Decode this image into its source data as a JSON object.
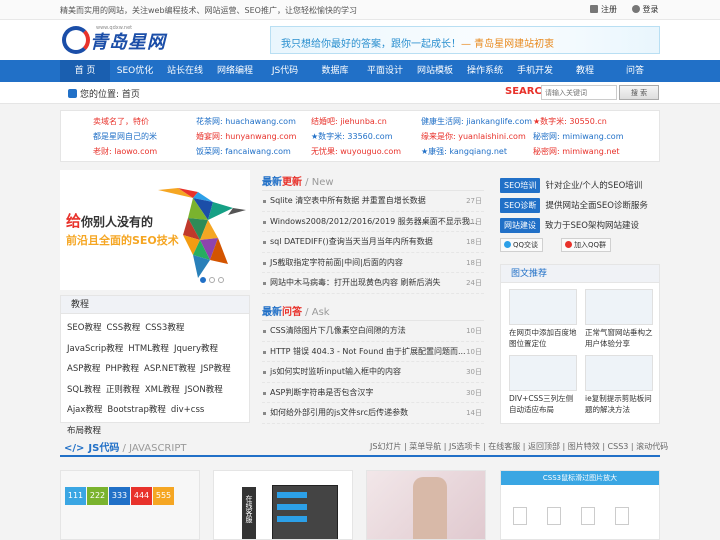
{
  "topbar": {
    "message": "精美而实用的网站，关注web编程技术、网站运营、SEO推广，让您轻松愉快的学习",
    "register": "注册",
    "login": "登录"
  },
  "header": {
    "logo_text": "青岛星网",
    "logo_sub": "www.qdxw.net",
    "banner_text": "我只想给你最好的答案，跟你一起成长！",
    "banner_brand": "— 青岛星网建站初衷"
  },
  "nav": [
    "首 页",
    "SEO优化",
    "站长在线",
    "网络编程",
    "JS代码",
    "数据库",
    "平面设计",
    "网站模板",
    "操作系统",
    "手机开发",
    "教程",
    "问答"
  ],
  "breadcrumb": {
    "label": "您的位置:",
    "current": "首页"
  },
  "search": {
    "brand": "SEARCH",
    "placeholder": "请输入关键词",
    "button": "搜 索"
  },
  "friends": [
    [
      {
        "text": "卖域名了，特价",
        "color": "#e8322b"
      },
      {
        "text": "花茶网: huachawang.com",
        "color": "#2170c7"
      },
      {
        "text": "结婚吧: jiehunba.cn",
        "color": "#e8322b"
      },
      {
        "text": "健康生活网: jiankanglife.com",
        "color": "#2170c7"
      },
      {
        "text": "★数字米: 30550.cn",
        "color": "#e8322b"
      }
    ],
    [
      {
        "text": "都是星网自己的米",
        "color": "#2170c7"
      },
      {
        "text": "婚宴网: hunyanwang.com",
        "color": "#e8322b"
      },
      {
        "text": "★数字米: 33560.com",
        "color": "#2170c7"
      },
      {
        "text": "缘来是你: yuanlaishini.com",
        "color": "#e8322b"
      },
      {
        "text": "秘密网: mimiwang.com",
        "color": "#2170c7"
      }
    ],
    [
      {
        "text": "老财: laowo.com",
        "color": "#e8322b"
      },
      {
        "text": "饭菜网: fancaiwang.com",
        "color": "#2170c7"
      },
      {
        "text": "无忧果: wuyouguo.com",
        "color": "#e8322b"
      },
      {
        "text": "★康强: kangqiang.net",
        "color": "#2170c7"
      },
      {
        "text": "秘密网: mimiwang.net",
        "color": "#e8322b"
      }
    ]
  ],
  "hero": {
    "line1_prefix": "给",
    "line1_rest": "你别人没有的",
    "line2": "前沿且全面的SEO技术"
  },
  "tutorials": {
    "title": "教程",
    "tags": [
      "SEO教程",
      "CSS教程",
      "CSS3教程",
      "JavaScrip教程",
      "HTML教程",
      "Jquery教程",
      "ASP教程",
      "PHP教程",
      "ASP.NET教程",
      "JSP教程",
      "SQL教程",
      "正则教程",
      "XML教程",
      "JSON教程",
      "Ajax教程",
      "Bootstrap教程",
      "div+css",
      "布局教程"
    ]
  },
  "latest": {
    "title_a": "最新",
    "title_b": "更新",
    "title_en": " / New",
    "items": [
      {
        "text": "Sqlite 清空表中所有数据 并重置自增长数据",
        "date": "27日"
      },
      {
        "text": "Windows2008/2012/2016/2019 服务器桌面不显示我...",
        "date": "31日"
      },
      {
        "text": "sql DATEDIFF()查询当天当月当年内所有数据",
        "date": "18日"
      },
      {
        "text": "JS截取指定字符前面|中间|后面的内容",
        "date": "18日"
      },
      {
        "text": "网站中木马病毒：打开出现黄色内容 刷新后消失",
        "date": "24日"
      }
    ]
  },
  "qa": {
    "title_a": "最新",
    "title_b": "问答",
    "title_en": " / Ask",
    "items": [
      {
        "text": "CSS清除图片下几像素空白间隙的方法",
        "date": "10日"
      },
      {
        "text": "HTTP 错误 404.3 - Not Found 由于扩展配置问题而...",
        "date": "10日"
      },
      {
        "text": "js如何实时监听input输入框中的内容",
        "date": "30日"
      },
      {
        "text": "ASP判断字符串是否包含汉字",
        "date": "30日"
      },
      {
        "text": "如何给外部引用的js文件src后传递参数",
        "date": "14日"
      }
    ]
  },
  "seo": [
    {
      "badge": "SEO培训",
      "text": "针对企业/个人的SEO培训"
    },
    {
      "badge": "SEO诊断",
      "text": "提供网站全面SEO诊断服务"
    },
    {
      "badge": "网站建设",
      "text": "致力于SEO架构网站建设"
    }
  ],
  "qq": {
    "chat": "QQ交谈",
    "group": "加入QQ群"
  },
  "pictures": {
    "title": "图文推荐",
    "items": [
      "在网页中添加百度地图位置定位",
      "正常气窗网站垂构之用户体验分享",
      "DIV+CSS三列左侧自动适应布局",
      "ie复制提示剪贴板问题的解决方法"
    ]
  },
  "js_section": {
    "title_a": "JS",
    "title_b": "代码",
    "title_en": " / JAVASCRIPT",
    "links": "JS幻灯片 | 菜单导航 | JS选项卡 | 在线客服 | 返回顶部 | 图片特效 | CSS3 | 滚动代码",
    "numbers": [
      "111",
      "222",
      "333",
      "444",
      "555"
    ],
    "number_colors": [
      "#3aa6e3",
      "#7ab32e",
      "#2170c7",
      "#e8322b",
      "#f5a623"
    ],
    "service_label": "在线客服",
    "css3_title": "CSS3鼠标滑过图片放大"
  }
}
